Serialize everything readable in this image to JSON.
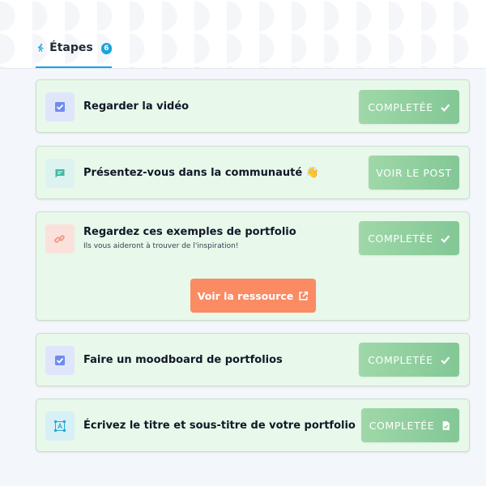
{
  "tab": {
    "label": "Étapes",
    "count": "6",
    "icon": "running-person-icon",
    "accent": "#1aa3dd"
  },
  "steps": [
    {
      "title": "Regarder la vidéo",
      "icon": "checkbox-icon",
      "button_label": "COMPLETÉE",
      "button_icon": "check-icon"
    },
    {
      "title": "Présentez-vous dans la communauté 👋",
      "icon": "chat-bubble-icon",
      "button_label": "VOIR LE POST"
    },
    {
      "title": "Regardez ces exemples de portfolio",
      "subtitle": "Ils vous aideront à trouver de l'inspiration!",
      "icon": "link-icon",
      "button_label": "COMPLETÉE",
      "button_icon": "check-icon",
      "resource_label": "Voir la ressource",
      "resource_icon": "external-link-icon"
    },
    {
      "title": "Faire un moodboard de portfolios",
      "icon": "checkbox-icon",
      "button_label": "COMPLETÉE",
      "button_icon": "check-icon"
    },
    {
      "title": "Écrivez le titre et sous-titre de votre portfolio",
      "icon": "text-frame-icon",
      "button_label": "COMPLETÉE",
      "button_icon": "document-icon"
    }
  ],
  "colors": {
    "card_bg": "#e8f8ea",
    "button_green": "#8fcf9e",
    "button_orange": "#fa8b63"
  }
}
